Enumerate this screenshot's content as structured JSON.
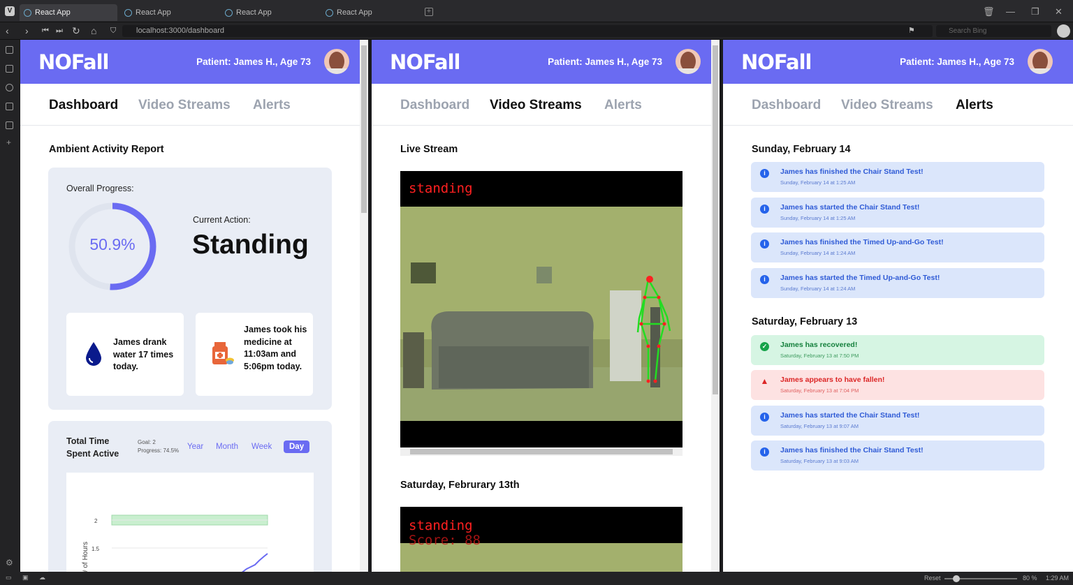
{
  "browser": {
    "tabs": [
      "React App",
      "React App",
      "React App",
      "React App"
    ],
    "url": "localhost:3000/dashboard",
    "search_placeholder": "Search Bing",
    "status": {
      "reset": "Reset",
      "zoom": "80 %",
      "time": "1:29 AM"
    }
  },
  "app": {
    "logo": "NOFall",
    "patient": "Patient: James H., Age 73",
    "nav": [
      "Dashboard",
      "Video Streams",
      "Alerts"
    ]
  },
  "dashboard": {
    "report_title": "Ambient Activity Report",
    "overall_label": "Overall Progress:",
    "progress_text": "50.9%",
    "progress_fraction": 0.509,
    "current_action_label": "Current Action:",
    "current_action": "Standing",
    "water_text": "James drank water 17 times today.",
    "medicine_text": "James took his medicine at 11:03am and 5:06pm today.",
    "active": {
      "title_line1": "Total Time",
      "title_line2": "Spent Active",
      "goal": "Goal: 2",
      "progress": "Progress: 74.5%",
      "ranges": [
        "Year",
        "Month",
        "Week",
        "Day"
      ],
      "selected_range": "Day"
    },
    "chart_data": {
      "type": "line",
      "ylabel": "# of Hours",
      "yticks": [
        "2",
        "1.5"
      ],
      "goal": 2
    }
  },
  "streams": {
    "live_title": "Live Stream",
    "live_label": "standing",
    "recorded_title": "Saturday, Februrary 13th",
    "recorded_label": "standing",
    "recorded_score": "Score: 88"
  },
  "alerts": {
    "groups": [
      {
        "date": "Sunday, February 14",
        "items": [
          {
            "kind": "info",
            "title": "James has finished the Chair Stand Test!",
            "time": "Sunday, February 14 at 1:25 AM"
          },
          {
            "kind": "info",
            "title": "James has started the Chair Stand Test!",
            "time": "Sunday, February 14 at 1:25 AM"
          },
          {
            "kind": "info",
            "title": "James has finished the Timed Up-and-Go Test!",
            "time": "Sunday, February 14 at 1:24 AM"
          },
          {
            "kind": "info",
            "title": "James has started the Timed Up-and-Go Test!",
            "time": "Sunday, February 14 at 1:24 AM"
          }
        ]
      },
      {
        "date": "Saturday, February 13",
        "items": [
          {
            "kind": "success",
            "title": "James has recovered!",
            "time": "Saturday, February 13 at 7:50 PM"
          },
          {
            "kind": "danger",
            "title": "James appears to have fallen!",
            "time": "Saturday, February 13 at 7:04 PM"
          },
          {
            "kind": "info",
            "title": "James has started the Chair Stand Test!",
            "time": "Saturday, February 13 at 9:07 AM"
          },
          {
            "kind": "info",
            "title": "James has finished the Chair Stand Test!",
            "time": "Saturday, February 13 at 9:03 AM"
          }
        ]
      }
    ]
  },
  "colors": {
    "accent": "#6a6bf2",
    "info": "#2563eb",
    "success": "#16a34a",
    "danger": "#dc2626"
  }
}
